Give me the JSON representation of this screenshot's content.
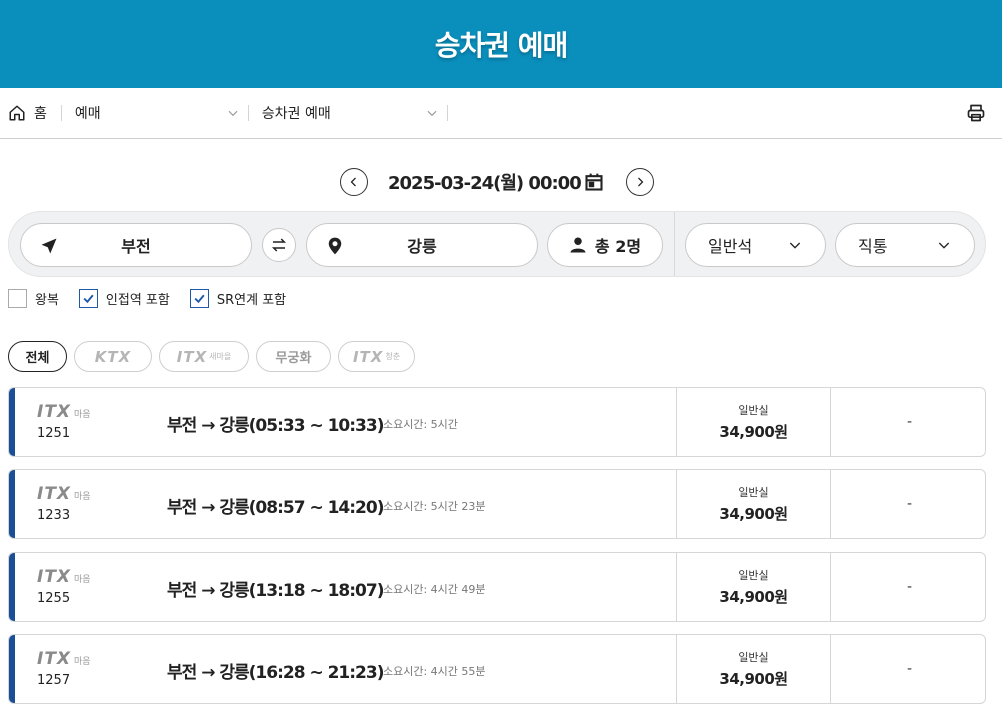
{
  "header": {
    "title": "승차권 예매"
  },
  "breadcrumb": {
    "home": "홈",
    "level1": "예매",
    "level2": "승차권 예매"
  },
  "date_selector": {
    "datetime": "2025-03-24(월) 00:00"
  },
  "search": {
    "departure": "부전",
    "arrival": "강릉",
    "passengers": "총 2명",
    "seat_type": "일반석",
    "route_type": "직통"
  },
  "options": [
    {
      "label": "왕복",
      "checked": false
    },
    {
      "label": "인접역 포함",
      "checked": true
    },
    {
      "label": "SR연계 포함",
      "checked": true
    }
  ],
  "filters": {
    "all": "전체",
    "ktx": "KTX",
    "itx_saemaeul": "ITX",
    "itx_saemaeul_sub": "새마을",
    "mugunghwa": "무궁화",
    "itx_cheongchun": "ITX",
    "itx_cheongchun_sub": "청춘"
  },
  "trains": [
    {
      "logo": "ITX",
      "logo_sub": "마음",
      "number": "1251",
      "route": "부전 → 강릉(05:33 ~ 10:33)",
      "duration": "소요시간: 5시간",
      "seat_class": "일반실",
      "price": "34,900원",
      "special": "-"
    },
    {
      "logo": "ITX",
      "logo_sub": "마음",
      "number": "1233",
      "route": "부전 → 강릉(08:57 ~ 14:20)",
      "duration": "소요시간: 5시간 23분",
      "seat_class": "일반실",
      "price": "34,900원",
      "special": "-"
    },
    {
      "logo": "ITX",
      "logo_sub": "마음",
      "number": "1255",
      "route": "부전 → 강릉(13:18 ~ 18:07)",
      "duration": "소요시간: 4시간 49분",
      "seat_class": "일반실",
      "price": "34,900원",
      "special": "-"
    },
    {
      "logo": "ITX",
      "logo_sub": "마음",
      "number": "1257",
      "route": "부전 → 강릉(16:28 ~ 21:23)",
      "duration": "소요시간: 4시간 55분",
      "seat_class": "일반실",
      "price": "34,900원",
      "special": "-"
    }
  ],
  "colors": {
    "header_bg": "#0a8fbd",
    "card_accent": "#1a4e97",
    "checkbox": "#1e58a8"
  }
}
